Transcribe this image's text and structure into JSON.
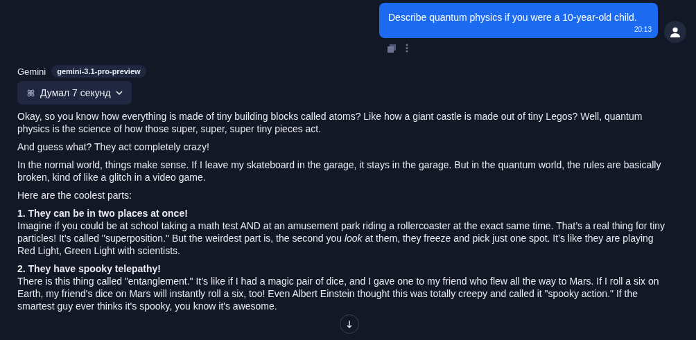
{
  "user_message": {
    "text": "Describe quantum physics if you were a 10-year-old child.",
    "time": "20:13"
  },
  "assistant": {
    "name": "Gemini",
    "model": "gemini-3.1-pro-preview",
    "thinking": {
      "label": "Думал 7 секунд",
      "expanded": false
    },
    "blocks": [
      {
        "kind": "text",
        "text": "Okay, so you know how everything is made of tiny building blocks called atoms? Like how a giant castle is made out of tiny Legos? Well, quantum physics is the science of how those super, super, super tiny pieces act."
      },
      {
        "kind": "text",
        "text": "And guess what? They act completely crazy!"
      },
      {
        "kind": "text",
        "text": "In the normal world, things make sense. If I leave my skateboard in the garage, it stays in the garage. But in the quantum world, the rules are basically broken, kind of like a glitch in a video game."
      },
      {
        "kind": "text",
        "text": "Here are the coolest parts:"
      },
      {
        "kind": "section",
        "heading": "1. They can be in two places at once!",
        "text": "Imagine if you could be at school taking a math test AND at an amusement park riding a rollercoaster at the exact same time. That’s a real thing for tiny particles! It’s called \"superposition.\" But the weirdest part is, the second you *look* at them, they freeze and pick just one spot. It’s like they are playing Red Light, Green Light with scientists."
      },
      {
        "kind": "section",
        "heading": "2. They have spooky telepathy!",
        "text": "There is this thing called \"entanglement.\" It’s like if I had a magic pair of dice, and I gave one to my friend who flew all the way to Mars. If I roll a six on Earth, my friend's dice on Mars will instantly roll a six, too! Even Albert Einstein thought this was totally creepy and called it \"spooky action.\" If the smartest guy ever thinks it's spooky, you know it's awesome."
      }
    ]
  }
}
